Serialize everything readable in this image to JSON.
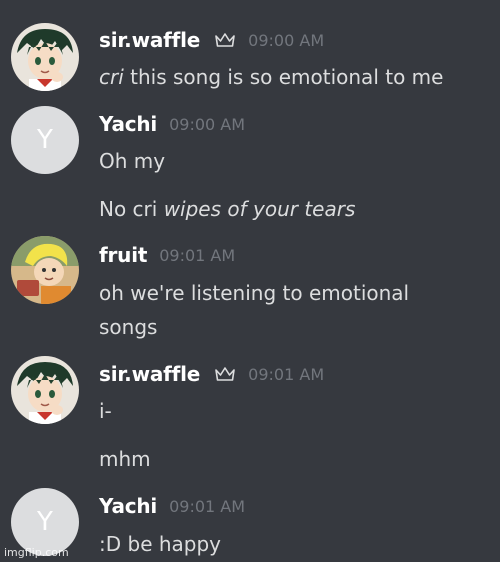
{
  "colors": {
    "background": "#36393f",
    "username": "#ffffff",
    "timestamp": "#72767d",
    "message_text": "#dcddde",
    "default_avatar_bg": "#dcdddf"
  },
  "messages": [
    {
      "username": "sir.waffle",
      "badge_icon": "crown-icon",
      "timestamp": "09:00 AM",
      "avatar": "anime-character-avatar",
      "lines": [
        {
          "italic_prefix": "cri",
          "text": " this song is so emotional to me"
        }
      ]
    },
    {
      "username": "Yachi",
      "timestamp": "09:00 AM",
      "avatar": "default-avatar",
      "avatar_letter": "Y",
      "lines": [
        {
          "text": "Oh my"
        },
        {
          "text": "No cri ",
          "italic_suffix": "wipes of your tears"
        }
      ]
    },
    {
      "username": "fruit",
      "timestamp": "09:01 AM",
      "avatar": "cartoon-character-avatar",
      "lines": [
        {
          "text": "oh we're listening to emotional"
        },
        {
          "text": "songs"
        }
      ]
    },
    {
      "username": "sir.waffle",
      "badge_icon": "crown-icon",
      "timestamp": "09:01 AM",
      "avatar": "anime-character-avatar",
      "lines": [
        {
          "text": "i-"
        },
        {
          "text": "mhm"
        }
      ]
    },
    {
      "username": "Yachi",
      "timestamp": "09:01 AM",
      "avatar": "default-avatar",
      "avatar_letter": "Y",
      "lines": [
        {
          "text": ":D be happy"
        }
      ]
    }
  ],
  "watermark": "imgflip.com"
}
